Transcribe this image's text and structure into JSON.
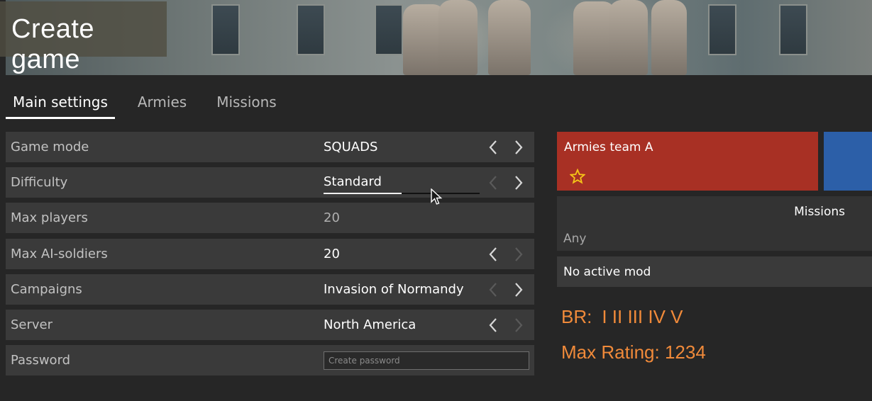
{
  "header": {
    "title": "Create game"
  },
  "tabs": [
    {
      "label": "Main settings",
      "active": true
    },
    {
      "label": "Armies",
      "active": false
    },
    {
      "label": "Missions",
      "active": false
    }
  ],
  "settings": {
    "game_mode": {
      "label": "Game mode",
      "value": "SQUADS"
    },
    "difficulty": {
      "label": "Difficulty",
      "value": "Standard",
      "slider_fraction": 0.5
    },
    "max_players": {
      "label": "Max players",
      "value": "20"
    },
    "max_ai": {
      "label": "Max AI-soldiers",
      "value": "20"
    },
    "campaigns": {
      "label": "Campaigns",
      "value": "Invasion of Normandy"
    },
    "server": {
      "label": "Server",
      "value": "North America"
    },
    "password": {
      "label": "Password",
      "placeholder": "Create password"
    }
  },
  "right": {
    "team_a": {
      "label": "Armies team A",
      "color": "#a83024"
    },
    "team_b": {
      "color": "#2c5fa8"
    },
    "missions": {
      "header": "Missions",
      "value": "Any"
    },
    "mod": "No active mod",
    "br_label": "BR:",
    "br_values": "I II III IV V",
    "max_rating": "Max Rating: 1234"
  },
  "icons": [
    "chevron-left-icon",
    "chevron-right-icon",
    "star-icon",
    "mouse-cursor-icon"
  ],
  "colors": {
    "accent_orange": "#f08a3a",
    "team_a_red": "#a83024",
    "team_b_blue": "#2c5fa8"
  }
}
